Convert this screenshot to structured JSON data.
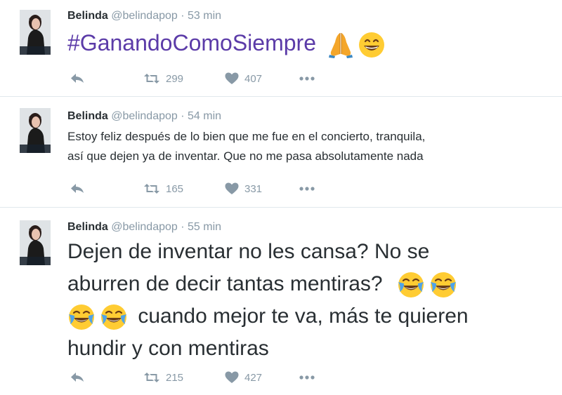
{
  "tweets": [
    {
      "name": "Belinda",
      "handle": "@belindapop",
      "separator": "·",
      "time": "53 min",
      "text": "#GanandoComoSiempre",
      "emojis": [
        "folded-hands",
        "grinning-face"
      ],
      "retweets": "299",
      "likes": "407"
    },
    {
      "name": "Belinda",
      "handle": "@belindapop",
      "separator": "·",
      "time": "54 min",
      "text_line1": "Estoy feliz después de lo bien que me fue en el concierto, tranquila,",
      "text_line2": "así que dejen ya de inventar. Que no me pasa absolutamente nada",
      "retweets": "165",
      "likes": "331"
    },
    {
      "name": "Belinda",
      "handle": "@belindapop",
      "separator": "·",
      "time": "55 min",
      "text_line1": "Dejen de inventar no les cansa? No se",
      "text_line2": "aburren de decir tantas mentiras?",
      "text_line3": "cuando mejor te va, más te quieren",
      "text_line4": "hundir y con mentiras",
      "emojis": [
        "face-with-tears-of-joy",
        "face-with-tears-of-joy",
        "face-with-tears-of-joy",
        "face-with-tears-of-joy"
      ],
      "retweets": "215",
      "likes": "427"
    }
  ],
  "colors": {
    "text": "#292f33",
    "meta": "#8899a6",
    "hashtag": "#5b3ba8",
    "divider": "#e1e8ed"
  }
}
